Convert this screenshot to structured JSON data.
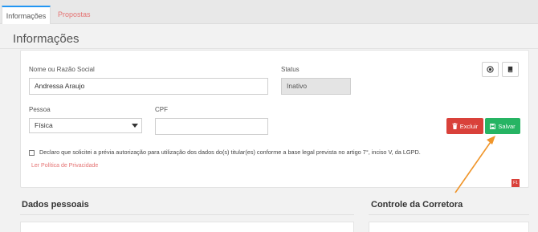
{
  "tabs": [
    {
      "label": "Informações"
    },
    {
      "label": "Propostas"
    }
  ],
  "page": {
    "title": "Informações"
  },
  "form": {
    "name_label": "Nome ou Razão Social",
    "name_value": "Andressa Araujo",
    "status_label": "Status",
    "status_value": "Inativo",
    "pessoa_label": "Pessoa",
    "pessoa_value": "Física",
    "cpf_label": "CPF",
    "cpf_value": ""
  },
  "buttons": {
    "delete_label": "Excluir",
    "save_label": "Salvar"
  },
  "consent": {
    "text": "Declaro que solicitei a prévia autorização para utilização dos dados do(s) titular(es) conforme a base legal prevista no artigo 7°, inciso V, da LGPD.",
    "privacy_link": "Ler Política de Privacidade"
  },
  "badge": {
    "text": "F1"
  },
  "sections": {
    "personal": "Dados pessoais",
    "broker": "Controle da Corretora"
  },
  "colors": {
    "danger": "#d9413a",
    "success": "#26b463",
    "link": "#e57373",
    "tab_accent": "#2196f3",
    "annotation_arrow": "#f0952a"
  },
  "icons": [
    "eye-icon",
    "book-icon",
    "trash-icon",
    "floppy-disk-icon",
    "chevron-down-icon",
    "annotation-arrow"
  ]
}
